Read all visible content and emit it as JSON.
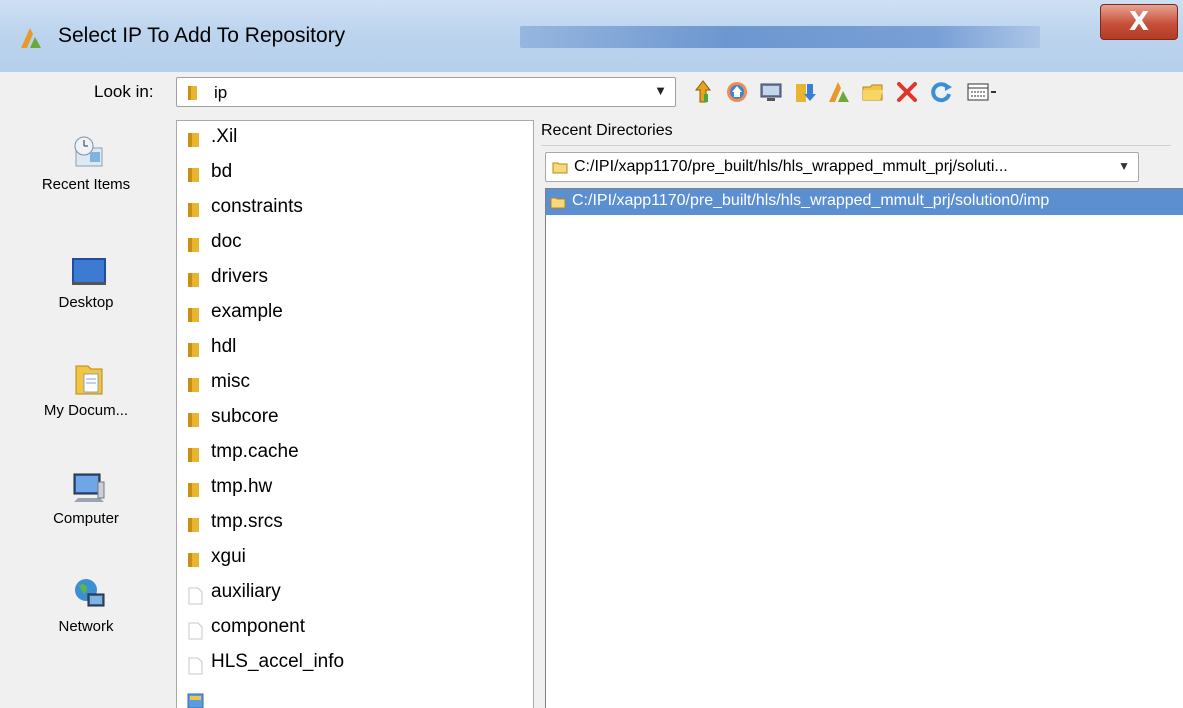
{
  "window": {
    "title": "Select IP To Add To Repository",
    "close_glyph": "X"
  },
  "lookin": {
    "label": "Look in:",
    "value": "ip"
  },
  "toolbar": {
    "icons": [
      "up-folder-icon",
      "home-icon",
      "desktop-icon",
      "download-icon",
      "vivado-icon",
      "new-folder-icon",
      "delete-icon",
      "refresh-icon",
      "view-menu-icon"
    ]
  },
  "places": [
    {
      "label": "Recent Items",
      "icon": "recent-items-icon"
    },
    {
      "label": "Desktop",
      "icon": "desktop-icon"
    },
    {
      "label": "My Docum...",
      "icon": "my-documents-icon"
    },
    {
      "label": "Computer",
      "icon": "computer-icon"
    },
    {
      "label": "Network",
      "icon": "network-icon"
    }
  ],
  "files": [
    {
      "name": ".Xil",
      "type": "folder"
    },
    {
      "name": "bd",
      "type": "folder"
    },
    {
      "name": "constraints",
      "type": "folder"
    },
    {
      "name": "doc",
      "type": "folder"
    },
    {
      "name": "drivers",
      "type": "folder"
    },
    {
      "name": "example",
      "type": "folder"
    },
    {
      "name": "hdl",
      "type": "folder"
    },
    {
      "name": "misc",
      "type": "folder"
    },
    {
      "name": "subcore",
      "type": "folder"
    },
    {
      "name": "tmp.cache",
      "type": "folder"
    },
    {
      "name": "tmp.hw",
      "type": "folder"
    },
    {
      "name": "tmp.srcs",
      "type": "folder"
    },
    {
      "name": "xgui",
      "type": "folder"
    },
    {
      "name": "auxiliary",
      "type": "file"
    },
    {
      "name": "component",
      "type": "file"
    },
    {
      "name": "HLS_accel_info",
      "type": "file"
    }
  ],
  "recent": {
    "label": "Recent Directories",
    "selected": "C:/IPI/xapp1170/pre_built/hls/hls_wrapped_mmult_prj/soluti...",
    "items": [
      "C:/IPI/xapp1170/pre_built/hls/hls_wrapped_mmult_prj/solution0/imp"
    ]
  },
  "colors": {
    "titlebar": "#bcd4ee",
    "selection": "#5b8fd0",
    "folder": "#e8b530",
    "close": "#c7503a"
  }
}
